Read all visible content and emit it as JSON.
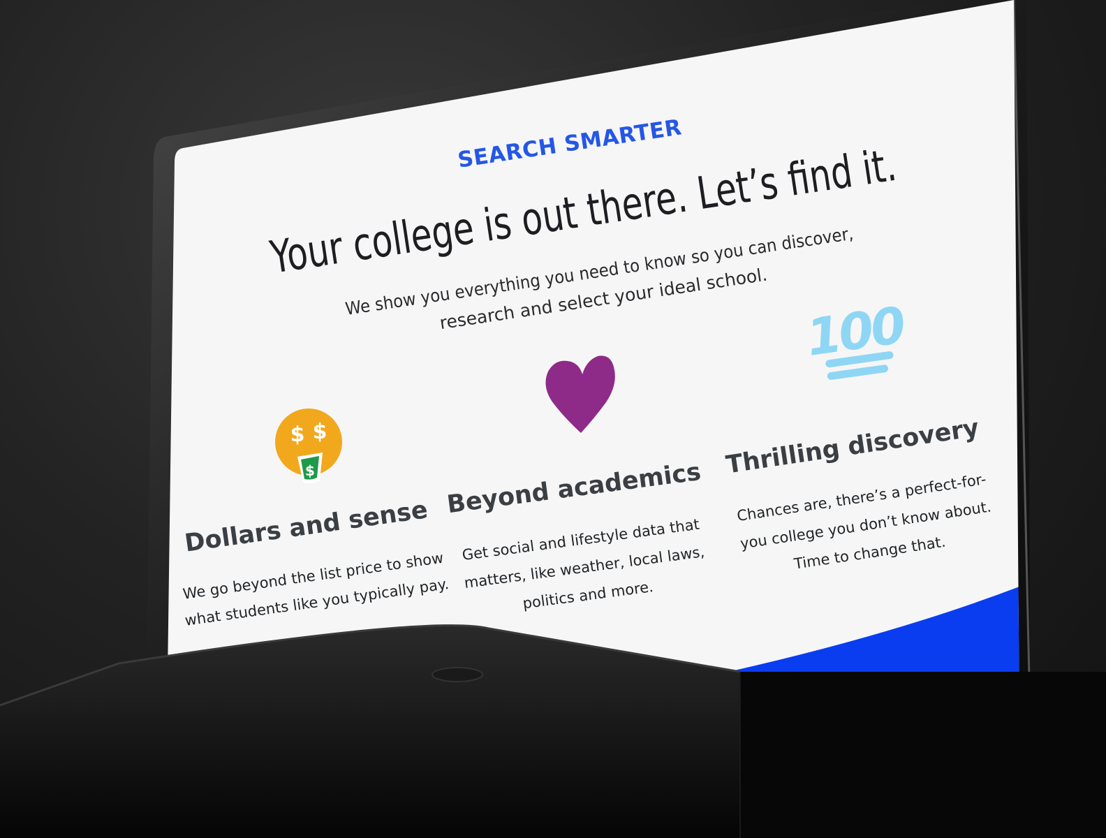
{
  "section": {
    "eyebrow": "SEARCH SMARTER",
    "headline": "Your college is out there. Let’s find it.",
    "lede_line1": "We show you everything you need to know so you can discover,",
    "lede_line2": "research and select your ideal school."
  },
  "features": [
    {
      "icon": "money-mouth-face-icon",
      "title": "Dollars and sense",
      "body_line1": "We go beyond the list price to show",
      "body_line2": "what students like you typically pay."
    },
    {
      "icon": "purple-heart-icon",
      "title": "Beyond academics",
      "body_line1": "Get social and lifestyle data that",
      "body_line2": "matters, like weather, local laws,",
      "body_line3": "politics and more."
    },
    {
      "icon": "hundred-points-icon",
      "title": "Thrilling discovery",
      "body_line1": "Chances are, there’s a perfect-for-",
      "body_line2": "you college you don’t know about.",
      "body_line3": "Time to change that."
    }
  ],
  "icon_glyphs": {
    "dollar": "$",
    "hundred": "100"
  },
  "colors": {
    "accent": "#2457e6",
    "wave": "#0a3df0",
    "coin_yellow": "#f2a81d",
    "heart_purple": "#8e2a87",
    "hundred_blue": "#8fd6f5",
    "money_green": "#1f9a4a",
    "heading_gray": "#3a3f44"
  }
}
